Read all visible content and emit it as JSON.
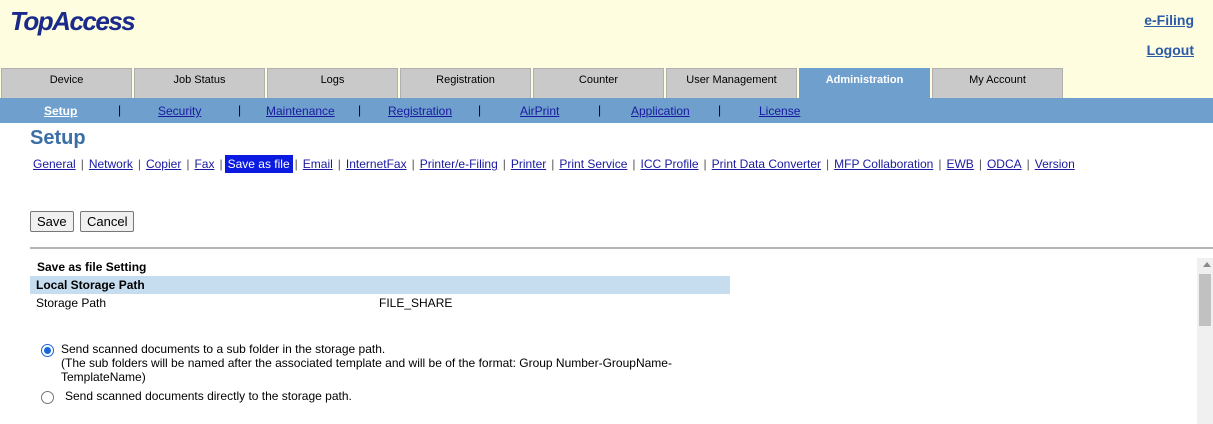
{
  "header": {
    "logo": "TopAccess",
    "efiling_link": "e-Filing",
    "logout_link": "Logout"
  },
  "tabs": [
    "Device",
    "Job Status",
    "Logs",
    "Registration",
    "Counter",
    "User Management",
    "Administration",
    "My Account"
  ],
  "active_tab": "Administration",
  "subnav": [
    "Setup",
    "Security",
    "Maintenance",
    "Registration",
    "AirPrint",
    "Application",
    "License"
  ],
  "active_subnav": "Setup",
  "page_title": "Setup",
  "subtabs": [
    "General",
    "Network",
    "Copier",
    "Fax",
    "Save as file",
    "Email",
    "InternetFax",
    "Printer/e-Filing",
    "Printer",
    "Print Service",
    "ICC Profile",
    "Print Data Converter",
    "MFP Collaboration",
    "EWB",
    "ODCA",
    "Version"
  ],
  "active_subtab": "Save as file",
  "buttons": {
    "save": "Save",
    "cancel": "Cancel"
  },
  "section": {
    "title": "Save as file Setting",
    "subsection": "Local Storage Path",
    "storage_path_label": "Storage Path",
    "storage_path_value": "FILE_SHARE"
  },
  "options": [
    {
      "line1": "Send scanned documents to a sub folder in the storage path.",
      "line2": "(The sub folders will be named after the associated template and will be of the format: Group Number-GroupName-",
      "line3": "TemplateName)",
      "selected": true
    },
    {
      "line1": "Send scanned documents directly to the storage path.",
      "selected": false
    }
  ]
}
